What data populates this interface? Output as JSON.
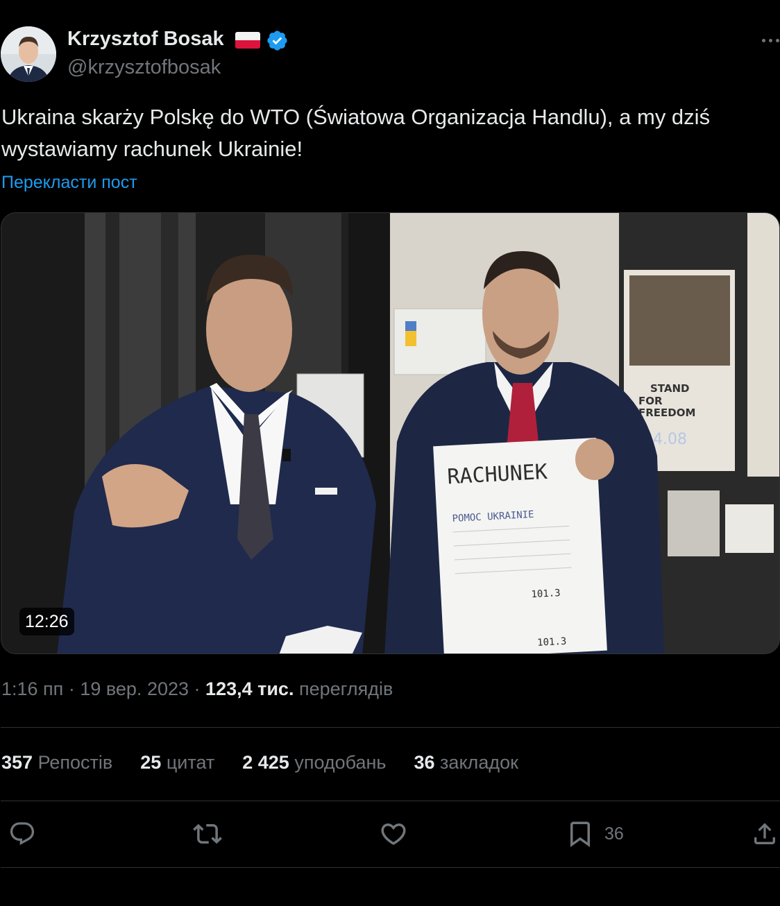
{
  "author": {
    "name": "Krzysztof Bosak",
    "handle": "@krzysztofbosak",
    "flag_icon": "poland-flag-icon",
    "verified_icon": "verified-badge-icon",
    "verified_color": "#1d9bf0"
  },
  "tweet": {
    "line1": "Ukraina skarży Polskę do WTO (Światowa Organizacja Handlu), a my dziś",
    "line2": "wystawiamy rachunek Ukrainie!",
    "translate_label": "Перекласти пост"
  },
  "media": {
    "duration": "12:26",
    "bill_title": "RACHUNEK",
    "bill_heading": "POMOC UKRAINIE",
    "bill_total": "101.3",
    "poster_text": [
      "STAND",
      "FOR",
      "FREEDOM"
    ],
    "poster_date": "24.08"
  },
  "meta": {
    "time": "1:16 пп",
    "separator": "·",
    "date": "19 вер. 2023",
    "views_count": "123,4 тис.",
    "views_label": "переглядів"
  },
  "stats": [
    {
      "count": "357",
      "label": "Репостів"
    },
    {
      "count": "25",
      "label": "цитат"
    },
    {
      "count": "2 425",
      "label": "уподобань"
    },
    {
      "count": "36",
      "label": "закладок"
    }
  ],
  "actions": {
    "reply_icon": "reply-icon",
    "repost_icon": "repost-icon",
    "like_icon": "like-icon",
    "bookmark_icon": "bookmark-icon",
    "bookmark_count": "36",
    "share_icon": "share-icon"
  },
  "colors": {
    "background": "#000000",
    "text": "#e7e9ea",
    "muted": "#71767b",
    "link": "#1d9bf0",
    "divider": "#2f3336"
  }
}
